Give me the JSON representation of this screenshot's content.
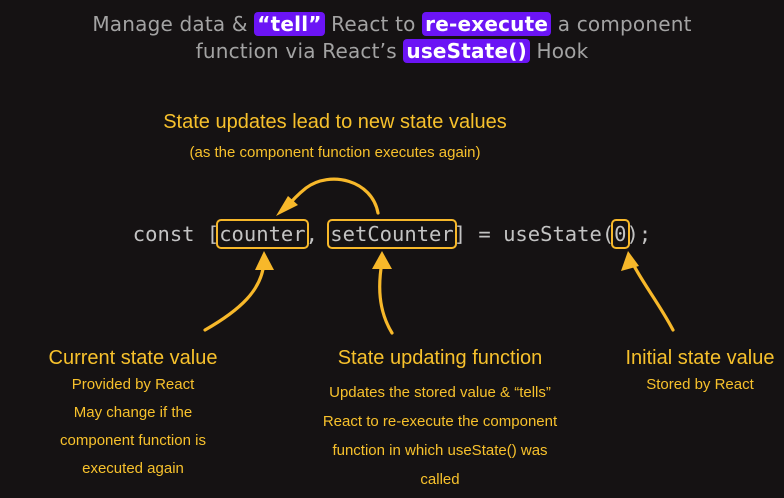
{
  "header": {
    "line1_pre": "Manage data & ",
    "line1_hl1": "“tell”",
    "line1_mid": " React to ",
    "line1_hl2": "re-execute",
    "line1_post": " a component",
    "line2_pre": "function via React’s ",
    "line2_hl": "useState()",
    "line2_post": " Hook"
  },
  "top_note": {
    "title": "State updates lead to new state values",
    "subtitle": "(as the component function executes again)"
  },
  "code": {
    "keyword": "const [",
    "state_var": "counter",
    "comma": ", ",
    "setter": "setCounter",
    "middle": "] = useState(",
    "initial": "0",
    "end": ");"
  },
  "annotations": {
    "current": {
      "title": "Current state value",
      "subtitle": "Provided by React",
      "detail": "May change if the component function is executed again"
    },
    "updater": {
      "title": "State updating function",
      "detail": "Updates the stored value & “tells” React to re-execute the component function in which useState() was called"
    },
    "initial": {
      "title": "Initial state value",
      "subtitle": "Stored by React"
    }
  },
  "colors": {
    "background": "#151213",
    "highlight": "#6b14f5",
    "annotation": "#f7c12c",
    "code": "#c3c3c3"
  }
}
